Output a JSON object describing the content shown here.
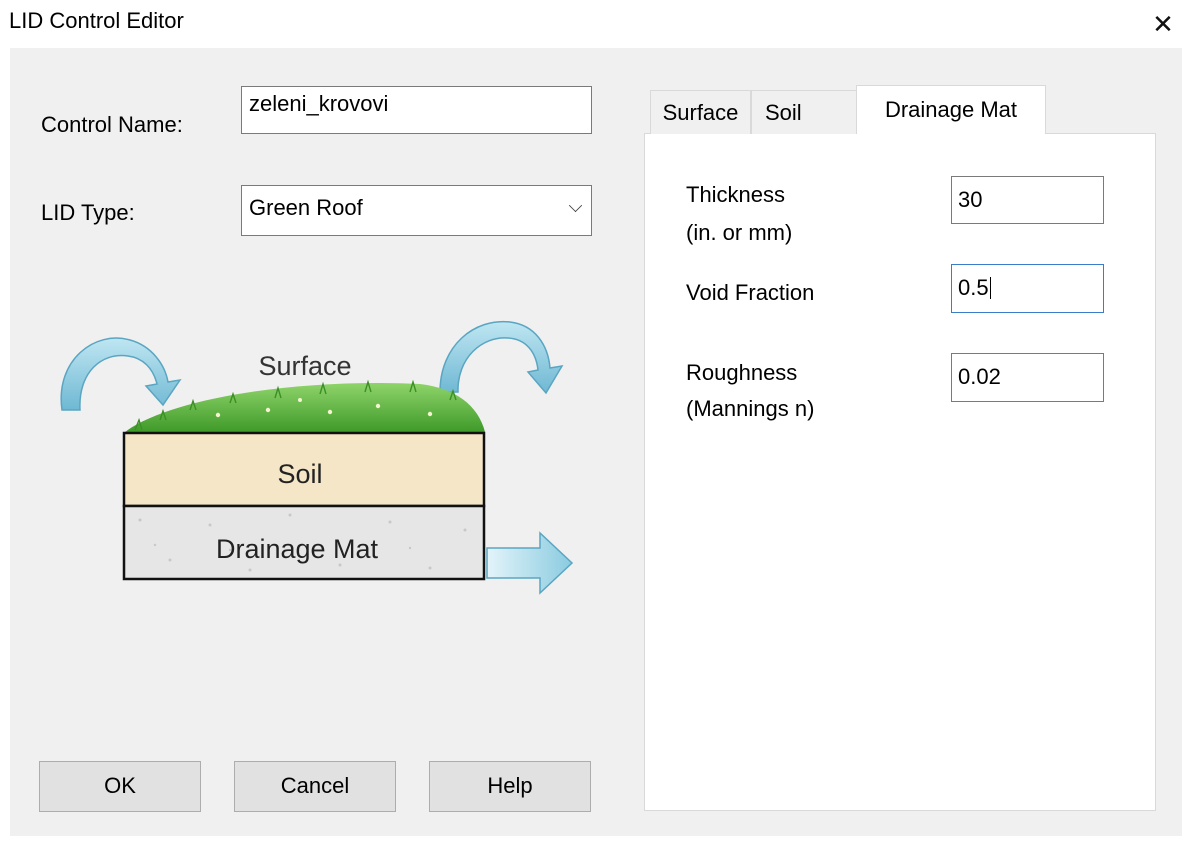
{
  "window": {
    "title": "LID Control Editor",
    "close_glyph": "✕"
  },
  "form": {
    "control_name_label": "Control Name:",
    "control_name_value": "zeleni_krovovi",
    "lid_type_label": "LID Type:",
    "lid_type_value": "Green Roof"
  },
  "diagram": {
    "surface_label": "Surface",
    "soil_label": "Soil",
    "drainage_label": "Drainage Mat",
    "colors": {
      "arrow": "#7fc4dc",
      "grass": "#5db33c",
      "soil": "#f5e6c8",
      "drainage": "#e6e6e6"
    }
  },
  "tabs": [
    {
      "label": "Surface",
      "active": false
    },
    {
      "label": "Soil",
      "active": false
    },
    {
      "label": "Drainage Mat",
      "active": true
    }
  ],
  "drainage_mat": {
    "thickness_label_1": "Thickness",
    "thickness_label_2": "(in. or mm)",
    "thickness_value": "30",
    "void_fraction_label": "Void Fraction",
    "void_fraction_value": "0.5",
    "roughness_label_1": "Roughness",
    "roughness_label_2": "(Mannings n)",
    "roughness_value": "0.02"
  },
  "buttons": {
    "ok": "OK",
    "cancel": "Cancel",
    "help": "Help"
  }
}
